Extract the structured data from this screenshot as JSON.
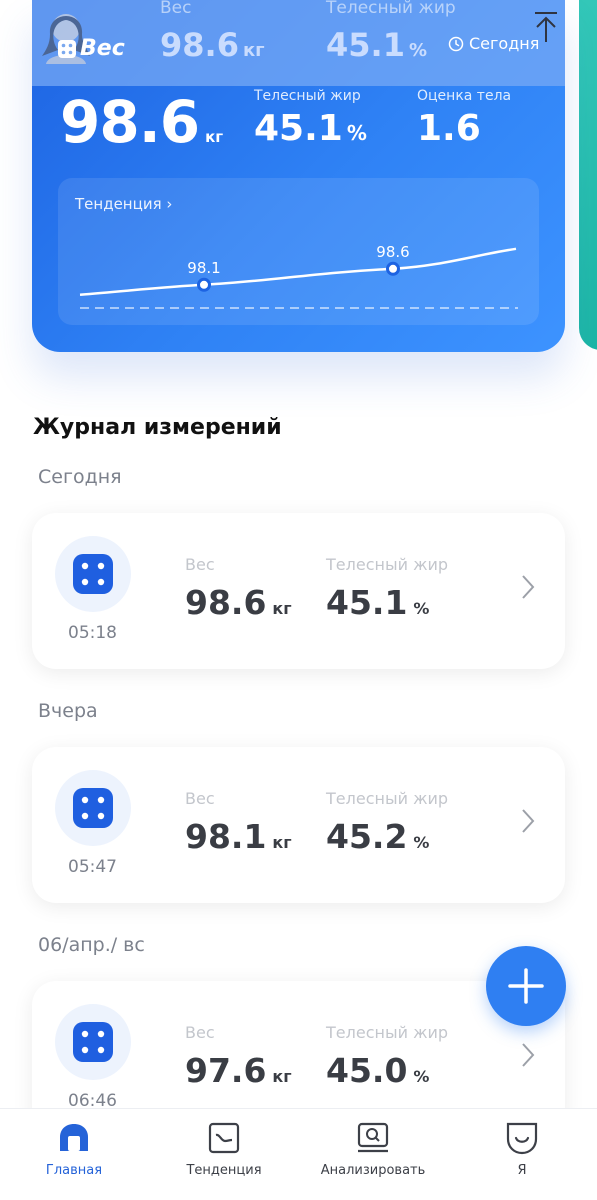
{
  "summary": {
    "weight": "98.6",
    "weight_unit": "кг",
    "body_fat_label": "Телесный жир",
    "body_fat": "45.1",
    "body_fat_unit": "%",
    "score_label": "Оценка тела",
    "score": "1.6",
    "trend_label": "Тенденция",
    "trend_chevron": "›",
    "trend_points": [
      {
        "label": "98.1",
        "value": 98.1
      },
      {
        "label": "98.6",
        "value": 98.6
      }
    ]
  },
  "sticky_header": {
    "logo": "Вес",
    "weight_label": "Вес",
    "weight": "98.6",
    "weight_unit": "кг",
    "fat_label": "Телесный жир",
    "fat": "45.1",
    "fat_unit": "%",
    "today": "Сегодня"
  },
  "log": {
    "title": "Журнал измерений",
    "groups": [
      {
        "date": "Сегодня",
        "time": "05:18",
        "weight_label": "Вес",
        "weight": "98.6",
        "weight_unit": "кг",
        "fat_label": "Телесный жир",
        "fat": "45.1",
        "fat_unit": "%"
      },
      {
        "date": "Вчера",
        "time": "05:47",
        "weight_label": "Вес",
        "weight": "98.1",
        "weight_unit": "кг",
        "fat_label": "Телесный жир",
        "fat": "45.2",
        "fat_unit": "%"
      },
      {
        "date": "06/апр./ вс",
        "time": "06:46",
        "weight_label": "Вес",
        "weight": "97.6",
        "weight_unit": "кг",
        "fat_label": "Телесный жир",
        "fat": "45.0",
        "fat_unit": "%"
      }
    ]
  },
  "tabs": [
    {
      "label": "Главная",
      "icon": "home-icon",
      "active": true
    },
    {
      "label": "Тенденция",
      "icon": "trend-icon",
      "active": false
    },
    {
      "label": "Анализировать",
      "icon": "analyze-icon",
      "active": false
    },
    {
      "label": "Я",
      "icon": "profile-icon",
      "active": false
    }
  ],
  "colors": {
    "accent": "#2f7ff2",
    "card_gradient_start": "#1d63e2",
    "card_gradient_end": "#3d93ff",
    "side_card": "#1cb5a5",
    "tab_active": "#2563d8"
  }
}
